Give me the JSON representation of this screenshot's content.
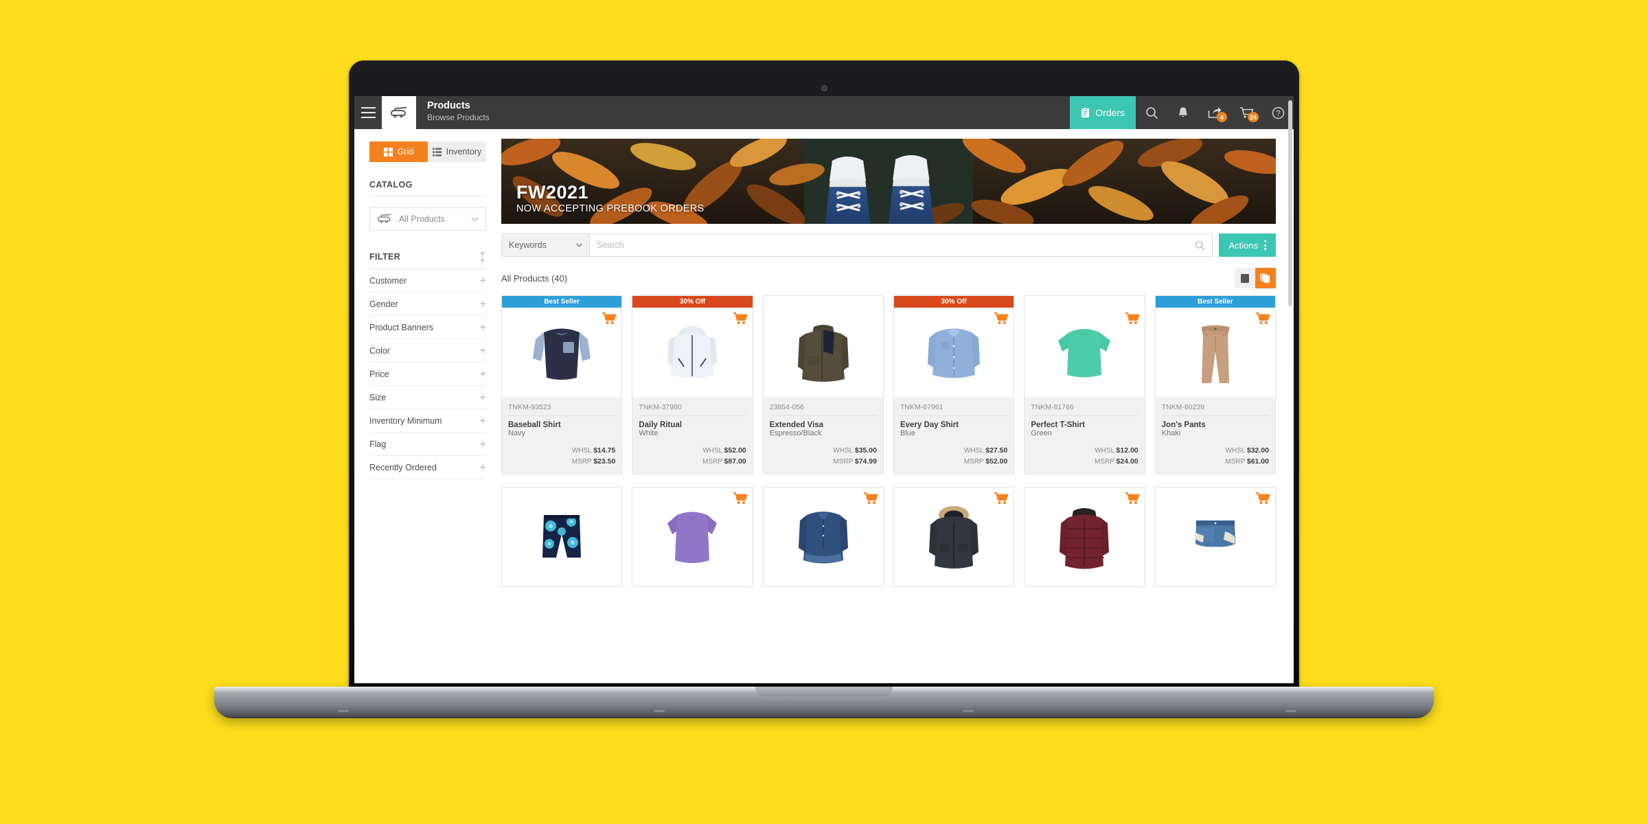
{
  "device": {
    "brand_label": "MacBook"
  },
  "background": {
    "color": "#FDDD1B"
  },
  "header": {
    "title": "Products",
    "subtitle": "Browse Products",
    "menu_icon": "hamburger-icon",
    "logo_icon": "brand-logo-icon",
    "orders_label": "Orders",
    "orders_icon": "clipboard-icon",
    "accent_teal": "#3DC6B4",
    "accent_orange": "#F5821F",
    "icons": [
      {
        "name": "search-icon",
        "badge": null
      },
      {
        "name": "bell-icon",
        "badge": null
      },
      {
        "name": "share-icon",
        "badge": "4"
      },
      {
        "name": "cart-icon",
        "badge": "24"
      },
      {
        "name": "help-icon",
        "badge": null
      }
    ]
  },
  "sidebar": {
    "view_toggle": [
      {
        "label": "Grid",
        "icon": "grid-icon",
        "active": true
      },
      {
        "label": "Inventory",
        "icon": "list-icon",
        "active": false
      }
    ],
    "catalog_label": "CATALOG",
    "catalog_select": {
      "value": "All Products",
      "icon": "brand-logo-icon",
      "chevron": "chevron-down-icon"
    },
    "filter_label": "FILTER",
    "filter_sort_icon": "sort-updown-icon",
    "filters": [
      {
        "label": "Customer"
      },
      {
        "label": "Gender"
      },
      {
        "label": "Product Banners"
      },
      {
        "label": "Color"
      },
      {
        "label": "Price"
      },
      {
        "label": "Size"
      },
      {
        "label": "Inventory Minimum"
      },
      {
        "label": "Flag"
      },
      {
        "label": "Recently Ordered"
      }
    ]
  },
  "banner": {
    "title": "FW2021",
    "subtitle": "NOW ACCEPTING PREBOOK ORDERS",
    "scene": "autumn-leaves-with-blue-sneakers"
  },
  "search": {
    "scope_label": "Keywords",
    "scope_chevron": "chevron-down-icon",
    "placeholder": "Search",
    "value": "",
    "search_icon": "search-icon",
    "actions_label": "Actions",
    "actions_menu_icon": "vertical-dots-icon"
  },
  "results": {
    "count_label": "All Products (40)",
    "layout_buttons": [
      {
        "name": "single-view-button",
        "icon": "square-icon",
        "active": false
      },
      {
        "name": "card-view-button",
        "icon": "stacked-cards-icon",
        "active": true
      }
    ]
  },
  "products": [
    {
      "sku": "TNKM-93523",
      "name": "Baseball Shirt",
      "color": "Navy",
      "whsl_label": "WHSL",
      "whsl": "$14.75",
      "msrp_label": "MSRP",
      "msrp": "$23.50",
      "badge": "Best Seller",
      "badge_type": "blue",
      "cart": true,
      "image": "baseball-raglan-shirt"
    },
    {
      "sku": "TNKM-37980",
      "name": "Daily Ritual",
      "color": "White",
      "whsl_label": "WHSL",
      "whsl": "$52.00",
      "msrp_label": "MSRP",
      "msrp": "$87.00",
      "badge": "30% Off",
      "badge_type": "red",
      "cart": true,
      "image": "white-hooded-jacket"
    },
    {
      "sku": "23854-056",
      "name": "Extended Visa",
      "color": "Espresso/Black",
      "whsl_label": "WHSL",
      "whsl": "$35.00",
      "msrp_label": "MSRP",
      "msrp": "$74.99",
      "badge": null,
      "badge_type": null,
      "cart": false,
      "image": "brown-fleece-jacket"
    },
    {
      "sku": "TNKM-67961",
      "name": "Every Day Shirt",
      "color": "Blue",
      "whsl_label": "WHSL",
      "whsl": "$27.50",
      "msrp_label": "MSRP",
      "msrp": "$52.00",
      "badge": "30% Off",
      "badge_type": "red",
      "cart": true,
      "image": "blue-button-shirt"
    },
    {
      "sku": "TNKM-81766",
      "name": "Perfect T-Shirt",
      "color": "Green",
      "whsl_label": "WHSL",
      "whsl": "$12.00",
      "msrp_label": "MSRP",
      "msrp": "$24.00",
      "badge": null,
      "badge_type": null,
      "cart": true,
      "image": "green-tshirt"
    },
    {
      "sku": "TNKM-80239",
      "name": "Jon's Pants",
      "color": "Khaki",
      "whsl_label": "WHSL",
      "whsl": "$32.00",
      "msrp_label": "MSRP",
      "msrp": "$61.00",
      "badge": "Best Seller",
      "badge_type": "blue",
      "cart": true,
      "image": "khaki-pants"
    }
  ],
  "products_row2": [
    {
      "image": "floral-swim-shorts",
      "cart": false
    },
    {
      "image": "purple-tee",
      "cart": true
    },
    {
      "image": "denim-shirt",
      "cart": true
    },
    {
      "image": "fur-hood-parka",
      "cart": true
    },
    {
      "image": "burgundy-puffer-coat",
      "cart": true
    },
    {
      "image": "denim-lace-shorts",
      "cart": true
    }
  ]
}
